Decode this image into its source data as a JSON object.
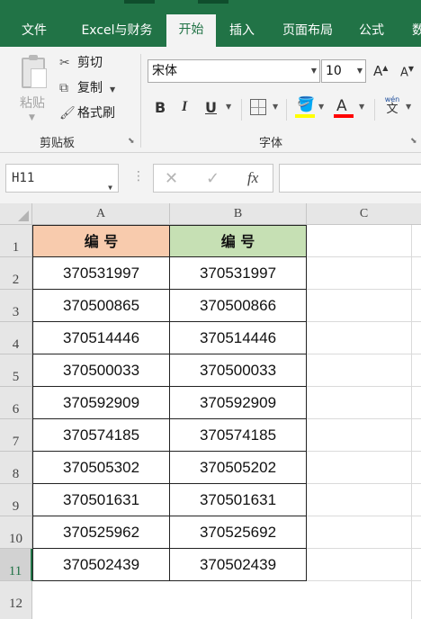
{
  "ribbon_tabs": [
    "文件",
    "Excel与财务",
    "开始",
    "插入",
    "页面布局",
    "公式",
    "数"
  ],
  "active_tab": "开始",
  "clipboard": {
    "paste_label": "粘贴",
    "cut_label": "剪切",
    "copy_label": "复制",
    "format_painter_label": "格式刷",
    "group_label": "剪贴板"
  },
  "font": {
    "font_name": "宋体",
    "font_size": "10",
    "grow_label": "A",
    "shrink_label": "A",
    "bold_label": "B",
    "italic_label": "I",
    "underline_label": "U",
    "font_color_label": "A",
    "phonetic_label": "wén",
    "phonetic_char": "文",
    "group_label": "字体",
    "fill_color": "#ffff00",
    "font_color": "#ff0000"
  },
  "formula_bar": {
    "name_box": "H11",
    "fx_label": "fx",
    "cancel_symbol": "✕",
    "enter_symbol": "✓",
    "formula": ""
  },
  "sheet": {
    "columns": [
      "A",
      "B",
      "C"
    ],
    "row_numbers": [
      "1",
      "2",
      "3",
      "4",
      "5",
      "6",
      "7",
      "8",
      "9",
      "10",
      "11",
      "12"
    ],
    "selected_row": "11",
    "header_a": "编 号",
    "header_b": "编 号",
    "header_a_color": "#f8cbad",
    "header_b_color": "#c6e0b4",
    "rows": [
      {
        "a": "370531997",
        "b": "370531997"
      },
      {
        "a": "370500865",
        "b": "370500866"
      },
      {
        "a": "370514446",
        "b": "370514446"
      },
      {
        "a": "370500033",
        "b": "370500033"
      },
      {
        "a": "370592909",
        "b": "370592909"
      },
      {
        "a": "370574185",
        "b": "370574185"
      },
      {
        "a": "370505302",
        "b": "370505202"
      },
      {
        "a": "370501631",
        "b": "370501631"
      },
      {
        "a": "370525962",
        "b": "370525692"
      },
      {
        "a": "370502439",
        "b": "370502439"
      }
    ]
  }
}
